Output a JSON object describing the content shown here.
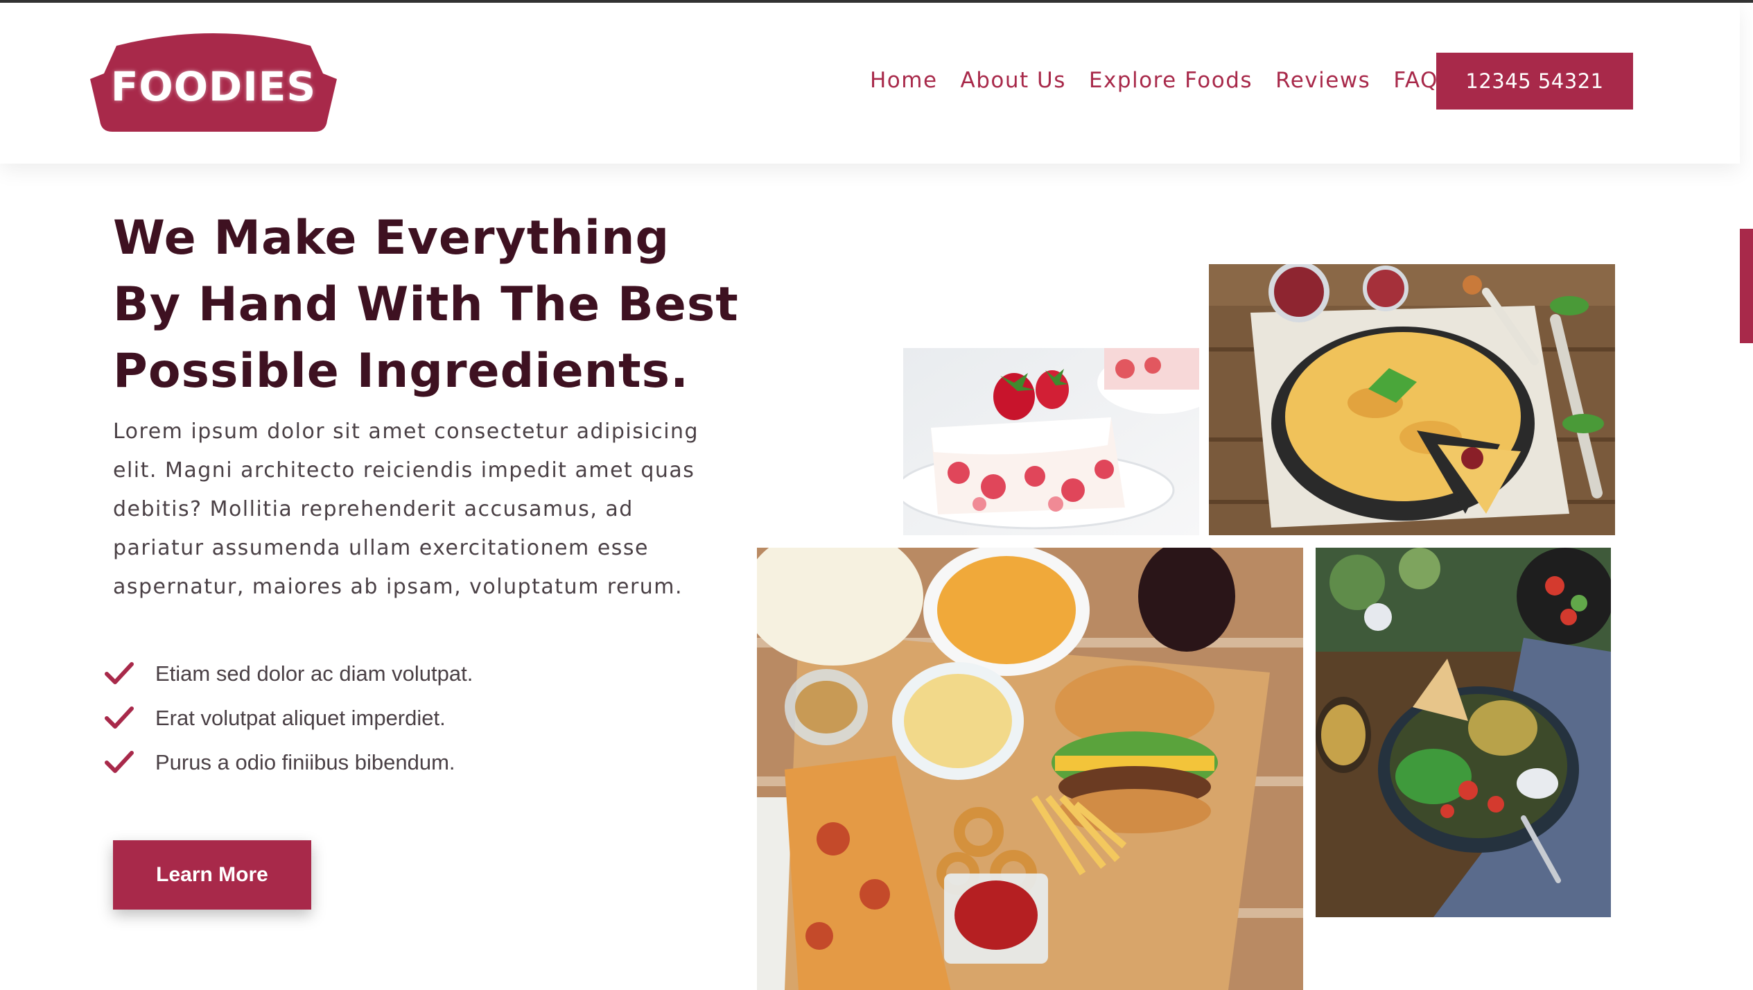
{
  "brand": {
    "logo_text": "FOODIES",
    "color": "#a8294a"
  },
  "nav": {
    "items": [
      {
        "label": "Home"
      },
      {
        "label": "About Us"
      },
      {
        "label": "Explore Foods"
      },
      {
        "label": "Reviews"
      },
      {
        "label": "FAQs"
      }
    ],
    "phone_label": "12345 54321"
  },
  "hero": {
    "title": "We Make Everything By Hand With The Best Possible Ingredients.",
    "paragraph": "Lorem ipsum dolor sit amet consectetur adipisicing elit. Magni architecto reiciendis impedit amet quas debitis? Mollitia reprehenderit accusamus, ad pariatur assumenda ullam exercitationem esse aspernatur, maiores ab ipsam, voluptatum rerum.",
    "features": [
      {
        "text": "Etiam sed dolor ac diam volutpat.",
        "icon": "check-icon"
      },
      {
        "text": "Erat volutpat aliquet imperdiet.",
        "icon": "check-icon"
      },
      {
        "text": "Purus a odio finiibus bibendum.",
        "icon": "check-icon"
      }
    ],
    "button_label": "Learn More"
  },
  "gallery": {
    "images": [
      {
        "name": "strawberry-cake-photo"
      },
      {
        "name": "omelette-photo"
      },
      {
        "name": "fast-food-photo"
      },
      {
        "name": "salad-bowl-photo"
      }
    ]
  },
  "colors": {
    "accent": "#a8294a",
    "heading": "#3e1121",
    "body_text": "#4a4045"
  }
}
